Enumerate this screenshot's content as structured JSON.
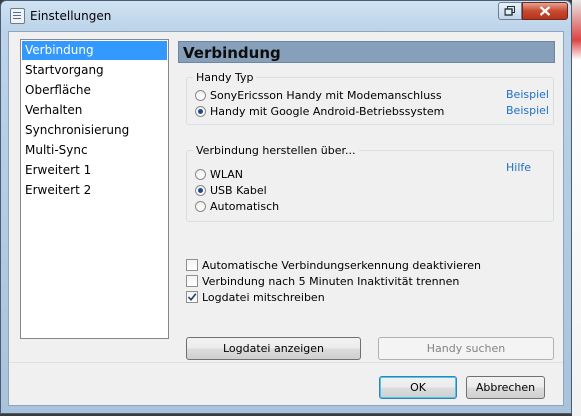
{
  "window": {
    "title": "Einstellungen"
  },
  "sidebar": {
    "items": [
      {
        "label": "Verbindung",
        "selected": true
      },
      {
        "label": "Startvorgang"
      },
      {
        "label": "Oberfläche"
      },
      {
        "label": "Verhalten"
      },
      {
        "label": "Synchronisierung"
      },
      {
        "label": "Multi-Sync"
      },
      {
        "label": "Erweitert 1"
      },
      {
        "label": "Erweitert 2"
      }
    ]
  },
  "panel": {
    "title": "Verbindung",
    "handy_typ": {
      "label": "Handy Typ",
      "options": [
        {
          "label": "SonyEricsson Handy mit Modemanschluss",
          "selected": false,
          "link": "Beispiel"
        },
        {
          "label": "Handy mit Google Android-Betriebssystem",
          "selected": true,
          "link": "Beispiel"
        }
      ]
    },
    "verbindung": {
      "label": "Verbindung herstellen über...",
      "help_link": "Hilfe",
      "options": [
        {
          "label": "WLAN",
          "selected": false
        },
        {
          "label": "USB Kabel",
          "selected": true
        },
        {
          "label": "Automatisch",
          "selected": false
        }
      ]
    },
    "checkboxes": [
      {
        "label": "Automatische Verbindungserkennung deaktivieren",
        "checked": false
      },
      {
        "label": "Verbindung nach 5 Minuten Inaktivität trennen",
        "checked": false
      },
      {
        "label": "Logdatei mitschreiben",
        "checked": true
      }
    ],
    "buttons": {
      "logdatei": "Logdatei anzeigen",
      "handy_suchen": "Handy suchen"
    }
  },
  "footer": {
    "ok": "OK",
    "cancel": "Abbrechen"
  },
  "colors": {
    "selection": "#3399ff",
    "link": "#1f6fc6",
    "header": "#86a0bb"
  }
}
